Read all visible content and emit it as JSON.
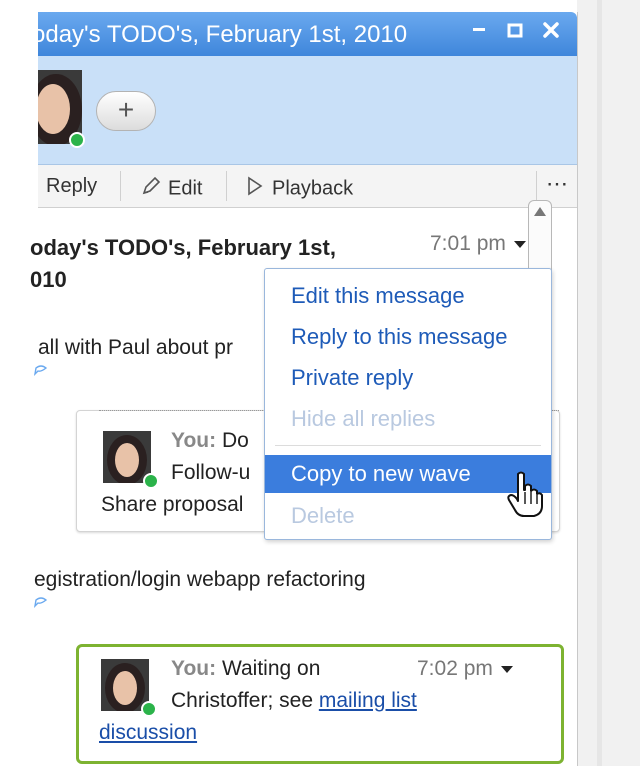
{
  "window": {
    "title": "oday's TODO's, February 1st, 2010",
    "controls": [
      "minimize",
      "maximize",
      "close"
    ]
  },
  "participants": {
    "add_label": "+"
  },
  "toolbar": {
    "reply": "Reply",
    "edit": "Edit",
    "playback": "Playback",
    "more": "⋯"
  },
  "blip": {
    "title_line1": "oday's TODO's, February 1st,",
    "title_line2": "010",
    "time": "7:01 pm",
    "line1": "all with Paul about pr",
    "line2": "egistration/login webapp refactoring"
  },
  "inline_reply_1": {
    "author": "You:",
    "text1": "Do",
    "text2": "Follow-u",
    "text3": "Share proposal"
  },
  "inline_reply_2": {
    "author": "You:",
    "text1": "Waiting on",
    "time": "7:02 pm",
    "text2": "Christoffer; see ",
    "link1": "mailing list",
    "link2": "discussion"
  },
  "context_menu": {
    "items": [
      {
        "label": "Edit this message",
        "state": "enabled"
      },
      {
        "label": "Reply to this message",
        "state": "enabled"
      },
      {
        "label": "Private reply",
        "state": "enabled"
      },
      {
        "label": "Hide all replies",
        "state": "disabled"
      },
      {
        "label": "Copy to new wave",
        "state": "selected"
      },
      {
        "label": "Delete",
        "state": "disabled"
      }
    ]
  },
  "colors": {
    "title_bar": "#4a90e2",
    "participants_bg": "#c9e0f8",
    "menu_highlight": "#3b7ddd",
    "menu_text": "#1e5bb8",
    "active_blip_border": "#7db331",
    "online_dot": "#2bb34a"
  }
}
